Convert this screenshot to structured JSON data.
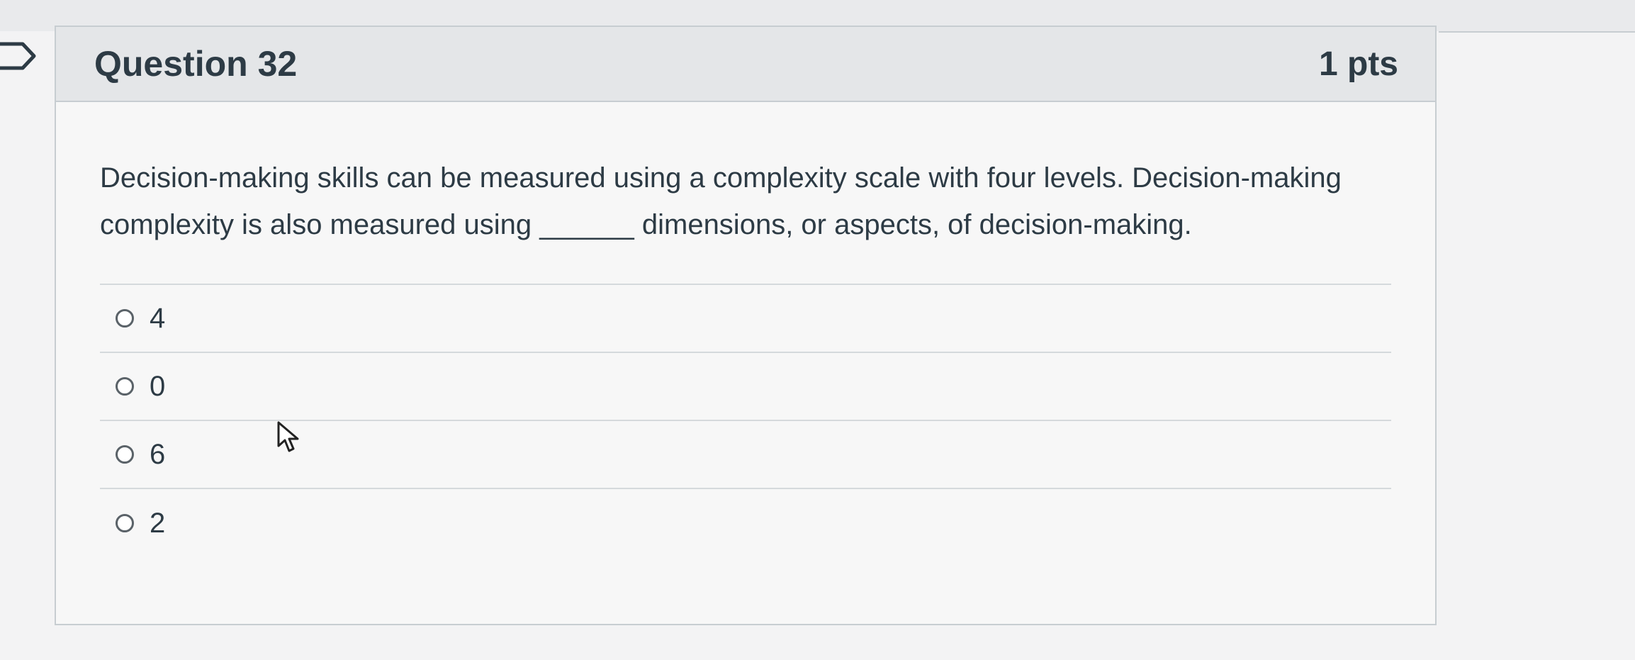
{
  "question": {
    "title": "Question 32",
    "points": "1 pts",
    "text": "Decision-making skills can be measured using a complexity scale with four levels. Decision-making complexity is also measured using ______ dimensions, or aspects, of decision-making.",
    "answers": [
      {
        "label": "4",
        "selected": false
      },
      {
        "label": "0",
        "selected": false
      },
      {
        "label": "6",
        "selected": false
      },
      {
        "label": "2",
        "selected": false
      }
    ]
  },
  "icons": {
    "flag": "flag-icon",
    "cursor": "mouse-pointer-icon",
    "radio": "radio-button-icon"
  },
  "colors": {
    "text": "#2d3b45",
    "header_background": "#e4e6e8",
    "border": "#c7cdd1"
  }
}
